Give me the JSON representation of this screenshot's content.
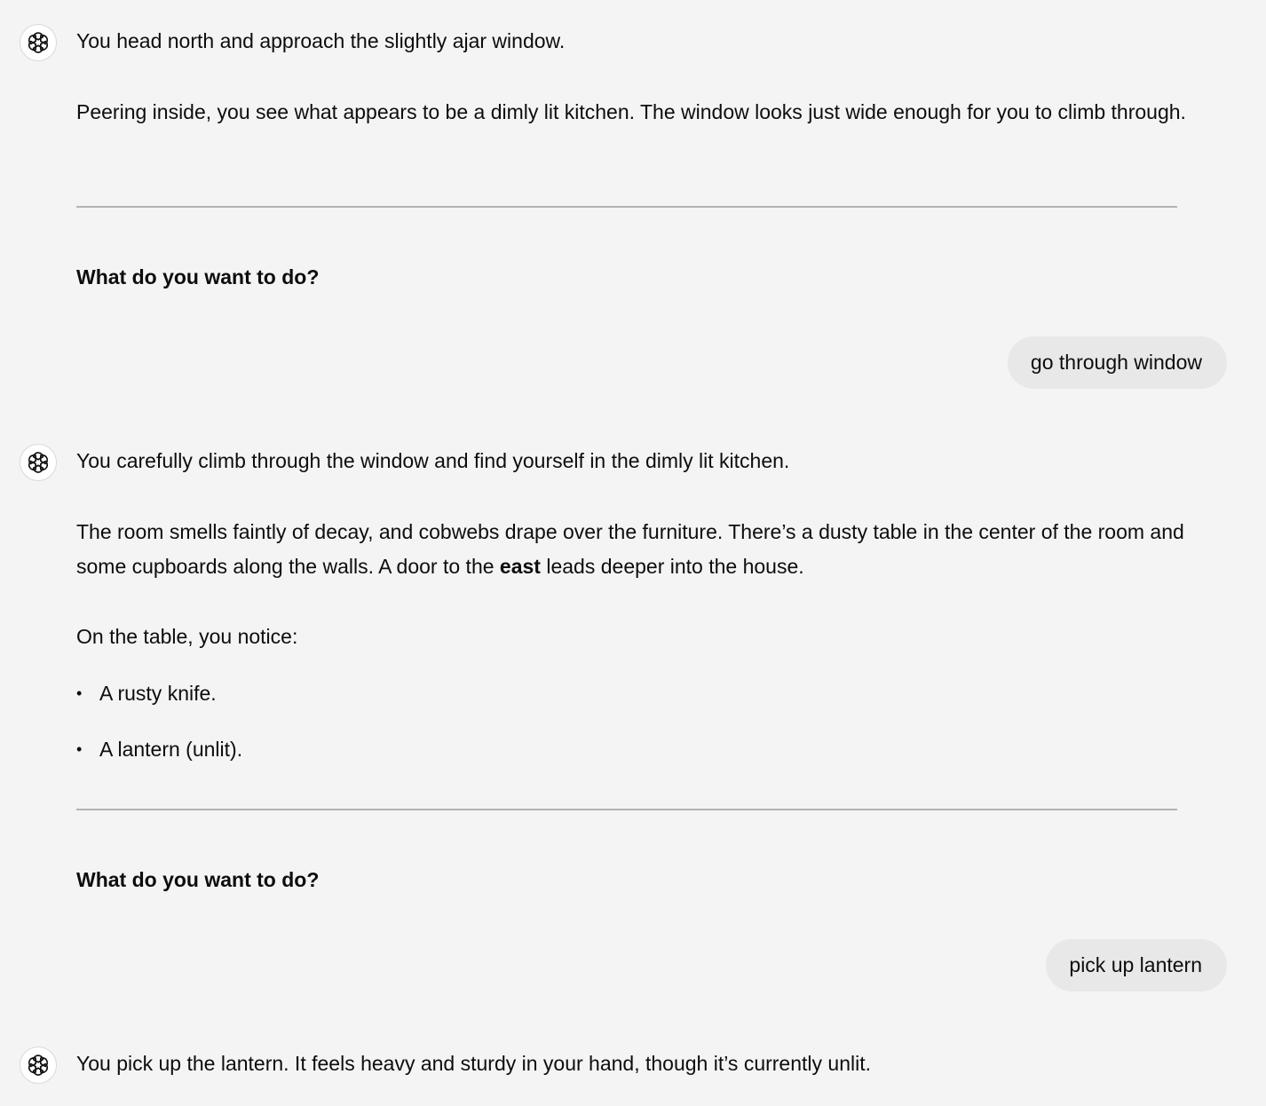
{
  "messages": [
    {
      "role": "assistant",
      "paragraphs": [
        "You head north and approach the slightly ajar window.",
        "Peering inside, you see what appears to be a dimly lit kitchen. The window looks just wide enough for you to climb through."
      ],
      "prompt": "What do you want to do?"
    },
    {
      "role": "user",
      "text": "go through window"
    },
    {
      "role": "assistant",
      "intro": "You carefully climb through the window and find yourself in the dimly lit kitchen.",
      "description_before_bold": "The room smells faintly of decay, and cobwebs drape over the furniture. There’s a dusty table in the center of the room and some cupboards along the walls. A door to the ",
      "description_bold": "east",
      "description_after_bold": " leads deeper into the house.",
      "list_intro": "On the table, you notice:",
      "items": [
        "A rusty knife.",
        "A lantern (unlit)."
      ],
      "prompt": "What do you want to do?"
    },
    {
      "role": "user",
      "text": "pick up lantern"
    },
    {
      "role": "assistant",
      "text": "You pick up the lantern. It feels heavy and sturdy in your hand, though it’s currently unlit."
    }
  ],
  "icons": {
    "assistant_avatar": "openai-logo-icon",
    "list_bullet": "bullet-icon"
  },
  "colors": {
    "background": "#f4f4f4",
    "user_bubble": "#e8e8e8",
    "divider": "#b3b3b3",
    "text": "#0d0d0d"
  }
}
